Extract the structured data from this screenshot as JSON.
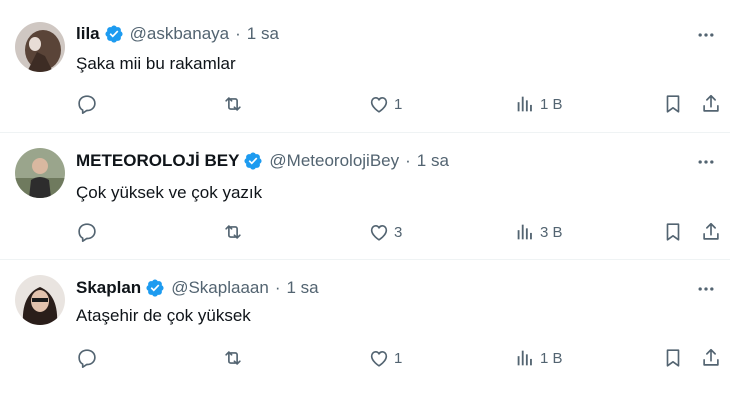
{
  "tweets": [
    {
      "name": "lila",
      "handle": "@askbanaya",
      "separator": "·",
      "time": "1 sa",
      "text": "Şaka mii bu rakamlar",
      "replies": "",
      "retweets": "",
      "likes": "1",
      "views": "1 B"
    },
    {
      "name": "METEOROLOJİ BEY",
      "handle": "@MeteorolojiBey",
      "separator": "·",
      "time": "1 sa",
      "text": "Çok yüksek ve çok yazık",
      "replies": "",
      "retweets": "",
      "likes": "3",
      "views": "3 B"
    },
    {
      "name": "Skaplan",
      "handle": "@Skaplaaan",
      "separator": "·",
      "time": "1 sa",
      "text": "Ataşehir de çok yüksek",
      "replies": "",
      "retweets": "",
      "likes": "1",
      "views": "1 B"
    }
  ],
  "icons": {
    "verified": "verified-badge-icon",
    "more": "more-icon",
    "reply": "reply-icon",
    "retweet": "retweet-icon",
    "like": "heart-icon",
    "views": "views-icon",
    "bookmark": "bookmark-icon",
    "share": "share-icon"
  },
  "colors": {
    "verified": "#1d9bf0",
    "text": "#0f1419",
    "secondary": "#536471",
    "divider": "#eff3f4"
  }
}
